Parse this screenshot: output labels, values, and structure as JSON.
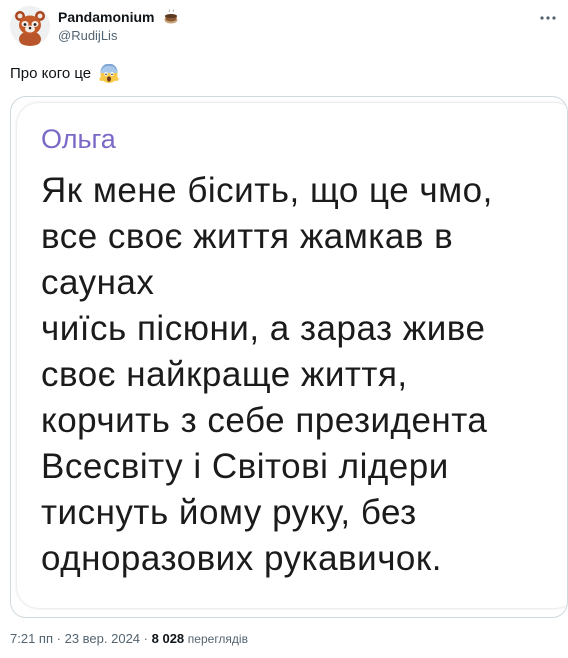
{
  "tweet": {
    "author": {
      "display_name": "Pandamonium",
      "handle": "@RudijLis",
      "name_emoji": "teacup-icon",
      "avatar": "red-panda-avatar"
    },
    "text": "Про кого це",
    "text_emoji": "screaming-face-icon",
    "media": {
      "sender": "Ольга",
      "lines": [
        "Як мене бісить, що це чмо,",
        "все своє життя жамкав в",
        "саунах",
        "чиїсь пісюни, а зараз живе",
        "своє найкраще життя,",
        "корчить з себе президента",
        "Всесвіту і Світові лідери",
        "тиснуть йому руку, без",
        "одноразових рукавичок."
      ]
    },
    "footer": {
      "time": "7:21 пп",
      "separator": "·",
      "date": "23 вер. 2024",
      "views_count": "8 028",
      "views_label": "переглядів"
    }
  },
  "colors": {
    "sender_name": "#7b68c7",
    "secondary_text": "#536471",
    "primary_text": "#0f1419",
    "border": "#cfd9de"
  }
}
